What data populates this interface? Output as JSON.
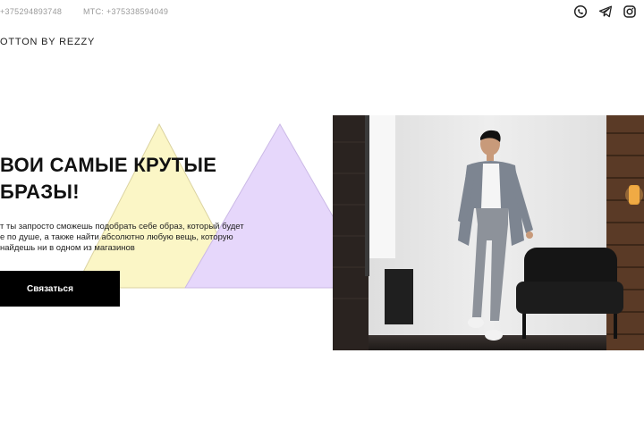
{
  "topbar": {
    "phone_1": "+375294893748",
    "phone_2": "МТС: +375338594049",
    "social": [
      {
        "icon": "viber-icon"
      },
      {
        "icon": "telegram-icon"
      },
      {
        "icon": "instagram-icon"
      }
    ]
  },
  "header": {
    "brand": "OTTON BY REZZY"
  },
  "hero": {
    "title_line_1": "ВОИ САМЫЕ КРУТЫЕ",
    "title_line_2": "БРАЗЫ!",
    "text_line_1": "т ты запросто сможешь подобрать себе образ, который будет",
    "text_line_2": "е по душе, а также найти абсолютно любую вещь, которую",
    "text_line_3": "найдешь ни в одном из магазинов",
    "button_label": "Связаться"
  },
  "colors": {
    "triangle_yellow": "#fbf6c6",
    "triangle_purple": "#e6d7fb",
    "button_bg": "#000000",
    "muted_text": "#9a9a9a"
  }
}
